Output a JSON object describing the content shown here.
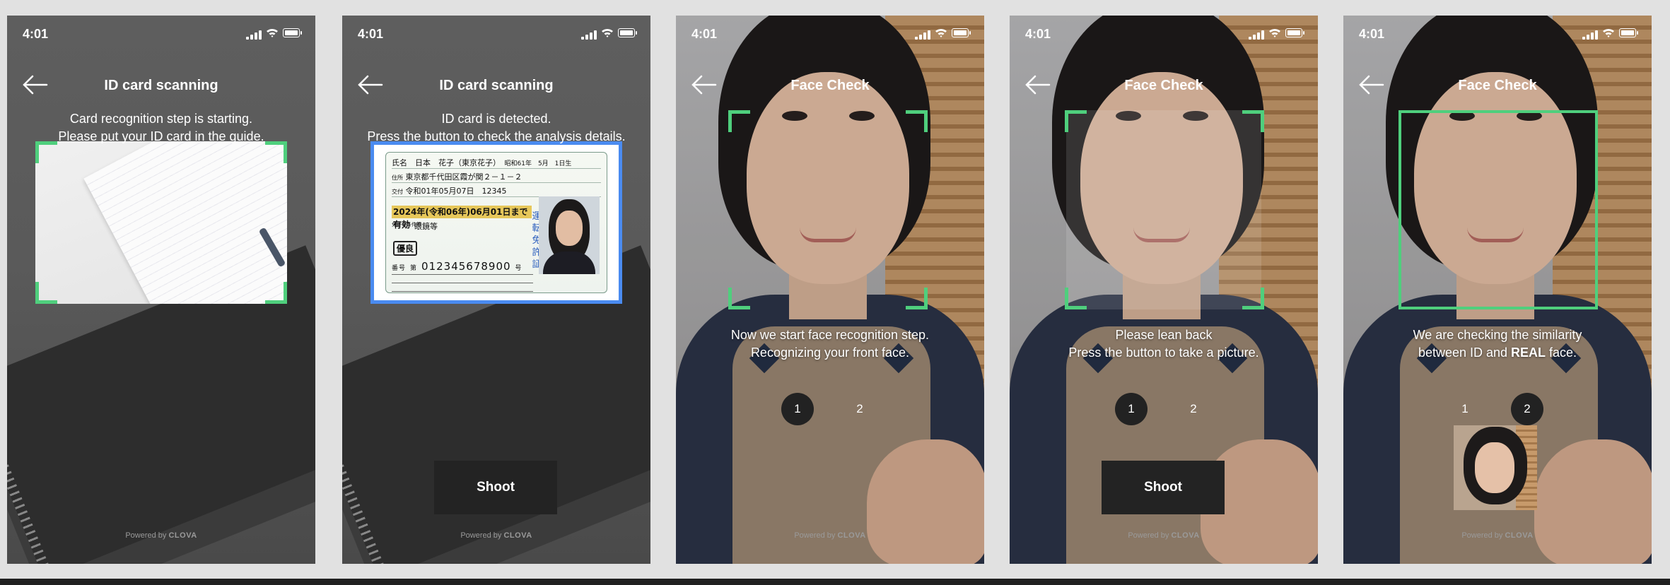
{
  "status_time": "4:01",
  "brand": {
    "powered_prefix": "Powered by",
    "powered_name": "CLOVA",
    "guide_green": "#4fcf7d",
    "detected_blue": "#4a8bf0"
  },
  "screens": [
    {
      "title": "ID card scanning",
      "message": [
        "Card recognition step is starting.",
        "Please put your ID card in the guide."
      ]
    },
    {
      "title": "ID card scanning",
      "message": [
        "ID card is detected.",
        "Press the button to check the analysis details."
      ],
      "button": "Shoot",
      "license": {
        "name_label": "氏名",
        "name": "日本　花子（東京花子）",
        "birth": "昭和61年　5月　1日生",
        "address_label": "住所",
        "address": "東京都千代田区霞が関２－１－２",
        "issue_label": "交付",
        "issue": "令和01年05月07日　12345",
        "expiry": "2024年(令和06年)06月01日まで有効",
        "condition_label": "免許の条件等",
        "condition": "眼鏡等",
        "badge": "優良",
        "number_label": "番号",
        "number_prefix": "第",
        "number": "012345678900",
        "number_suffix": "号",
        "vertical": "運転免許証"
      }
    },
    {
      "title": "Face Check",
      "message": [
        "Now we start face recognition step.",
        "Recognizing your front face."
      ],
      "steps": [
        "1",
        "2"
      ],
      "active_step": 0
    },
    {
      "title": "Face Check",
      "message": [
        "Please lean back",
        "Press the button to take a picture."
      ],
      "steps": [
        "1",
        "2"
      ],
      "active_step": 0,
      "button": "Shoot"
    },
    {
      "title": "Face Check",
      "message": [
        "We are checking the similarity",
        "between ID and REAL face."
      ],
      "steps": [
        "1",
        "2"
      ],
      "active_step": 1
    }
  ]
}
